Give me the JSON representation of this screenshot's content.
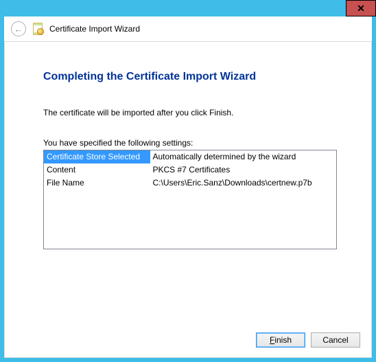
{
  "window": {
    "close_label": "✕"
  },
  "header": {
    "back_arrow": "←",
    "title": "Certificate Import Wizard"
  },
  "main": {
    "heading": "Completing the Certificate Import Wizard",
    "instruction": "The certificate will be imported after you click Finish.",
    "settings_label": "You have specified the following settings:",
    "rows": [
      {
        "key": "Certificate Store Selected",
        "value": "Automatically determined by the wizard"
      },
      {
        "key": "Content",
        "value": "PKCS #7 Certificates"
      },
      {
        "key": "File Name",
        "value": "C:\\Users\\Eric.Sanz\\Downloads\\certnew.p7b"
      }
    ]
  },
  "buttons": {
    "finish": "Finish",
    "cancel": "Cancel"
  }
}
